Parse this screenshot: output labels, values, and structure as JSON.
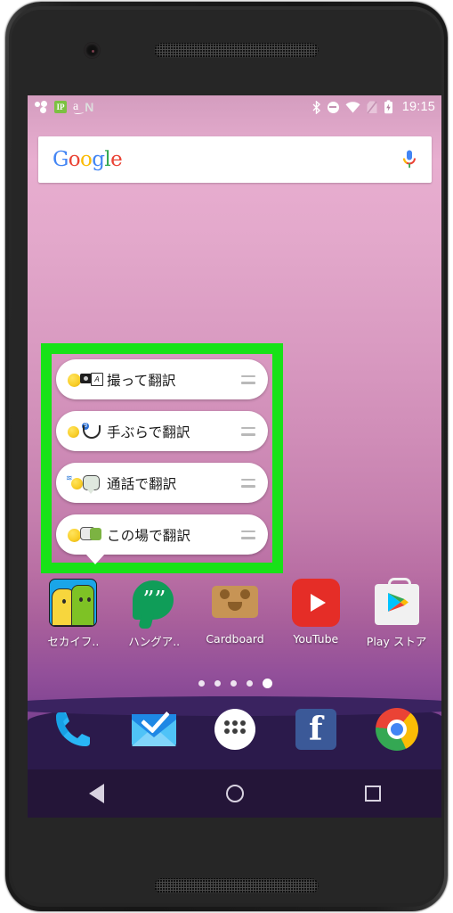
{
  "device": {
    "name": "android-phone",
    "frame_color": "#1d1d1d"
  },
  "status_bar": {
    "time": "19:15",
    "left_icons": [
      {
        "name": "share-icon",
        "label": "share"
      },
      {
        "name": "app-green-icon",
        "label": "IP"
      },
      {
        "name": "amazon-icon",
        "label": "a"
      },
      {
        "name": "n-app-icon",
        "label": "N"
      }
    ],
    "right_icons": [
      {
        "name": "bluetooth-icon",
        "label": "bluetooth"
      },
      {
        "name": "do-not-disturb-icon",
        "label": "do-not-disturb"
      },
      {
        "name": "wifi-icon",
        "label": "wifi"
      },
      {
        "name": "no-sim-icon",
        "label": "no-sim"
      },
      {
        "name": "battery-charging-icon",
        "label": "battery"
      }
    ]
  },
  "search": {
    "logo_letters": [
      "G",
      "o",
      "o",
      "g",
      "l",
      "e"
    ],
    "mic_icon": "microphone-icon",
    "placeholder": ""
  },
  "shortcuts": {
    "highlight_color": "#18e218",
    "items": [
      {
        "label": "撮って翻訳",
        "icon": "camera-translate-icon",
        "handle": "drag-handle-icon"
      },
      {
        "label": "手ぶらで翻訳",
        "icon": "hands-free-translate-icon",
        "handle": "drag-handle-icon"
      },
      {
        "label": "通話で翻訳",
        "icon": "call-translate-icon",
        "handle": "drag-handle-icon"
      },
      {
        "label": "この場で翻訳",
        "icon": "on-the-spot-translate-icon",
        "handle": "drag-handle-icon"
      }
    ]
  },
  "apps": [
    {
      "label": "セカイフ..",
      "icon": "sekai-phone-icon"
    },
    {
      "label": "ハングア..",
      "icon": "hangouts-icon"
    },
    {
      "label": "Cardboard",
      "icon": "cardboard-icon"
    },
    {
      "label": "YouTube",
      "icon": "youtube-icon"
    },
    {
      "label": "Play ストア",
      "icon": "play-store-icon"
    }
  ],
  "page_indicator": {
    "count": 5,
    "active_index": 4
  },
  "dock": [
    {
      "name": "phone-icon",
      "label": "Phone"
    },
    {
      "name": "inbox-mail-icon",
      "label": "Inbox"
    },
    {
      "name": "app-drawer-icon",
      "label": "Apps"
    },
    {
      "name": "facebook-icon",
      "label": "f"
    },
    {
      "name": "chrome-icon",
      "label": "Chrome"
    }
  ],
  "nav_bar": [
    {
      "name": "nav-back-button",
      "label": "Back"
    },
    {
      "name": "nav-home-button",
      "label": "Home"
    },
    {
      "name": "nav-recents-button",
      "label": "Recents"
    }
  ]
}
